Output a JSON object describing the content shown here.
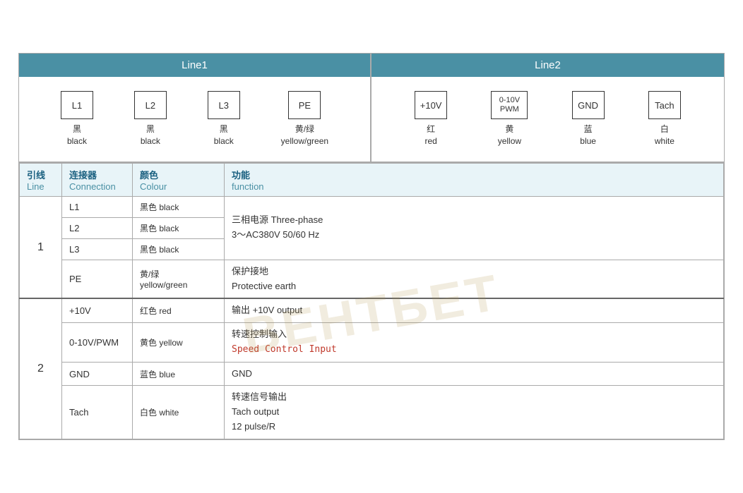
{
  "header": {
    "line1_label": "Line1",
    "line2_label": "Line2"
  },
  "line1_connectors": [
    {
      "id": "conn-l1",
      "box_label": "L1",
      "zh_label": "黑",
      "en_label": "black"
    },
    {
      "id": "conn-l2",
      "box_label": "L2",
      "zh_label": "黑",
      "en_label": "black"
    },
    {
      "id": "conn-l3",
      "box_label": "L3",
      "zh_label": "黑",
      "en_label": "black"
    },
    {
      "id": "conn-pe",
      "box_label": "PE",
      "zh_label": "黄/绿",
      "en_label": "yellow/green"
    }
  ],
  "line2_connectors": [
    {
      "id": "conn-10v",
      "box_label": "+10V",
      "zh_label": "红",
      "en_label": "red"
    },
    {
      "id": "conn-pwm",
      "box_label": "0-10V\nPWM",
      "zh_label": "黄",
      "en_label": "yellow"
    },
    {
      "id": "conn-gnd",
      "box_label": "GND",
      "zh_label": "蓝",
      "en_label": "blue"
    },
    {
      "id": "conn-tach",
      "box_label": "Tach",
      "zh_label": "白",
      "en_label": "white"
    }
  ],
  "table_headers": {
    "line_zh": "引线",
    "line_en": "Line",
    "connection_zh": "连接器",
    "connection_en": "Connection",
    "color_zh": "颜色",
    "color_en": "Colour",
    "function_zh": "功能",
    "function_en": "function"
  },
  "rows_line1": [
    {
      "connection": "L1",
      "color_zh": "黑色",
      "color_en": "black",
      "function_lines": [
        "三相电源 Three-phase",
        "3～AC380V 50/60 Hz"
      ],
      "rowspan": 3
    },
    {
      "connection": "L2",
      "color_zh": "黑色",
      "color_en": "black",
      "function_lines": []
    },
    {
      "connection": "L3",
      "color_zh": "黑色",
      "color_en": "black",
      "function_lines": []
    },
    {
      "connection": "PE",
      "color_zh": "黄/绿",
      "color_en": "yellow/green",
      "function_lines": [
        "保护接地",
        "Protective earth"
      ]
    }
  ],
  "rows_line2": [
    {
      "connection": "+10V",
      "color_zh": "红色",
      "color_en": "red",
      "function_lines": [
        "输出 +10V output"
      ],
      "rowspan": 4
    },
    {
      "connection": "0-10V/PWM",
      "color_zh": "黄色",
      "color_en": "yellow",
      "function_lines": [
        "转速控制输入",
        "Speed Control Input"
      ]
    },
    {
      "connection": "GND",
      "color_zh": "蓝色",
      "color_en": "blue",
      "function_lines": [
        "GND"
      ]
    },
    {
      "connection": "Tach",
      "color_zh": "白色",
      "color_en": "white",
      "function_lines": [
        "转速信号输出",
        "Tach output",
        "12 pulse/R"
      ]
    }
  ],
  "watermark": "ВЕНТБЕТ"
}
